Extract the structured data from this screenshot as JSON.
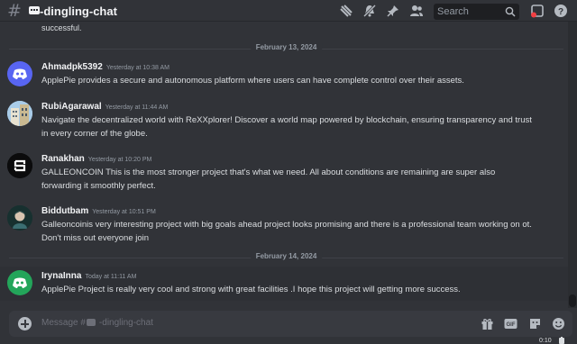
{
  "header": {
    "channel_name": "-dingling-chat",
    "search_placeholder": "Search"
  },
  "messages_top_cut": "successful.",
  "dates": {
    "first": "February 13, 2024",
    "second": "February 14, 2024"
  },
  "messages": [
    {
      "author": "Ahmadpk5392",
      "timestamp": "Yesterday at 10:38 AM",
      "text": "ApplePie provides a secure and autonomous platform where users can have complete control over their assets.",
      "avatar": "discord-blurple"
    },
    {
      "author": "RubiAgarawal",
      "timestamp": "Yesterday at 11:44 AM",
      "text": "Navigate the decentralized world with ReXXplorer! Discover a world map powered by blockchain, ensuring transparency and trust in every corner of the globe.",
      "avatar": "building-photo"
    },
    {
      "author": "Ranakhan",
      "timestamp": "Yesterday at 10:20 PM",
      "text": "GALLEONCOIN This is the most stronger project that's what we need. All about conditions are remaining are super also forwarding it smoothly perfect.",
      "avatar": "s-logo"
    },
    {
      "author": "Biddutbam",
      "timestamp": "Yesterday at 10:51 PM",
      "text": "Galleoncoinis very interesting project with big goals ahead project looks promising and there is a professional team working on ot. Don't miss out everyone join",
      "avatar": "character-art"
    },
    {
      "author": "IrynaInna",
      "timestamp": "Today at 11:11 AM",
      "text": "ApplePie Project is  really very cool and strong with great facilities .I hope this project will getting more success.",
      "avatar": "discord-green"
    }
  ],
  "composer": {
    "placeholder_prefix": "Message #",
    "placeholder_channel": "-dingling-chat"
  },
  "footer_time": "0:10",
  "colors": {
    "background": "#313338",
    "blurple": "#5865f2",
    "green": "#23a55a",
    "notification_red": "#f23f43"
  }
}
